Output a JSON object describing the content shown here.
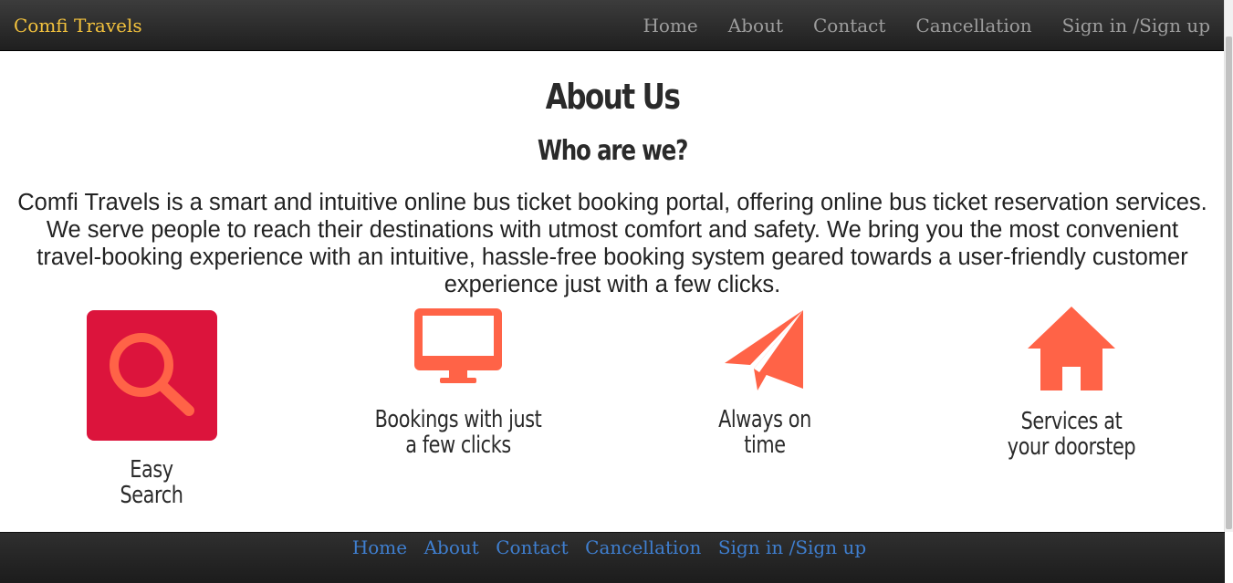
{
  "navbar": {
    "brand": "Comfi Travels",
    "links": [
      "Home",
      "About",
      "Contact",
      "Cancellation",
      "Sign in /Sign up"
    ]
  },
  "main": {
    "title": "About Us",
    "subtitle": "Who are we?",
    "intro": "Comfi Travels is a smart and intuitive online bus ticket booking portal, offering online bus ticket reservation services. We serve people to reach their destinations with utmost comfort and safety. We bring you the most convenient travel-booking experience with an intuitive, hassle-free booking system geared towards a user-friendly customer experience just with a few clicks.",
    "features": [
      {
        "icon": "search-icon",
        "label": "Easy\nSearch"
      },
      {
        "icon": "monitor-icon",
        "label": "Bookings with just\na few clicks"
      },
      {
        "icon": "paper-plane-icon",
        "label": "Always on\ntime"
      },
      {
        "icon": "home-icon",
        "label": "Services at\nyour doorstep"
      }
    ]
  },
  "footer": {
    "links": [
      "Home",
      "About",
      "Contact",
      "Cancellation",
      "Sign in /Sign up"
    ]
  },
  "colors": {
    "brand": "#f3c23d",
    "icon_accent": "#ff6347",
    "search_tile": "#dc143c",
    "footer_link": "#3f7fd0"
  }
}
